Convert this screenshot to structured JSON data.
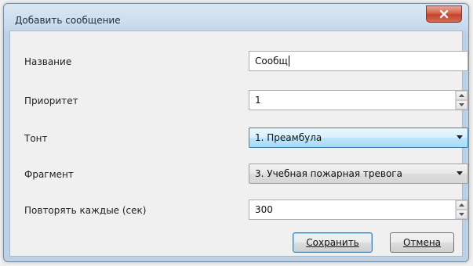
{
  "window": {
    "title": "Добавить сообщение"
  },
  "form": {
    "name": {
      "label": "Название",
      "value": "Сообщ"
    },
    "priority": {
      "label": "Приоритет",
      "value": "1"
    },
    "tone": {
      "label": "Тонт",
      "value": "1. Преамбула"
    },
    "fragment": {
      "label": "Фрагмент",
      "value": "3. Учебная пожарная тревога"
    },
    "repeat": {
      "label": "Повторять каждые (сек)",
      "value": "300"
    }
  },
  "buttons": {
    "save": "Сохранить",
    "cancel": "Отмена"
  },
  "colors": {
    "close_button": "#c4432d",
    "focus_border": "#3c7fb1"
  }
}
